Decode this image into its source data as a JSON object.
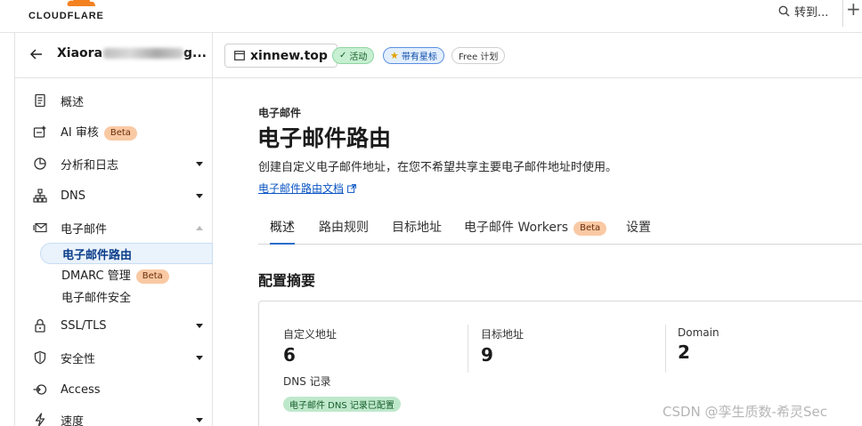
{
  "brand": {
    "name": "CLOUDFLARE",
    "accent_color": "#f48120"
  },
  "topbar": {
    "goto_label": "转到...",
    "add_label": "+"
  },
  "sidebar": {
    "account_name_prefix": "Xiaora",
    "account_name_suffix": "g...",
    "items": [
      {
        "label": "概述",
        "icon": "document-icon"
      },
      {
        "label": "AI 审核",
        "icon": "ai-audit-icon",
        "badge": "Beta"
      },
      {
        "label": "分析和日志",
        "icon": "chart-icon"
      },
      {
        "label": "DNS",
        "icon": "dns-network-icon"
      },
      {
        "label": "电子邮件",
        "icon": "email-icon"
      },
      {
        "label": "SSL/TLS",
        "icon": "lock-icon"
      },
      {
        "label": "安全性",
        "icon": "shield-icon"
      },
      {
        "label": "Access",
        "icon": "access-icon"
      },
      {
        "label": "速度",
        "icon": "lightning-icon"
      }
    ],
    "email_subitems": [
      {
        "label": "电子邮件路由",
        "active": true
      },
      {
        "label": "DMARC 管理",
        "badge": "Beta"
      },
      {
        "label": "电子邮件安全"
      }
    ]
  },
  "zone": {
    "name": "xinnew.top",
    "status": "活动",
    "starred": "带有星标",
    "plan": "Free 计划"
  },
  "page": {
    "breadcrumb": "电子邮件",
    "title": "电子邮件路由",
    "description": "创建自定义电子邮件地址，在您不希望共享主要电子邮件地址时使用。",
    "doc_link": "电子邮件路由文档"
  },
  "tabs": [
    {
      "label": "概述",
      "active": true
    },
    {
      "label": "路由规则"
    },
    {
      "label": "目标地址"
    },
    {
      "label": "电子邮件 Workers",
      "badge": "Beta"
    },
    {
      "label": "设置"
    }
  ],
  "summary": {
    "title": "配置摘要",
    "stats": [
      {
        "label": "自定义地址",
        "value": "6"
      },
      {
        "label": "目标地址",
        "value": "9"
      },
      {
        "label": "Domain",
        "value": "2"
      }
    ],
    "dns_label": "DNS 记录",
    "dns_status": "电子邮件 DNS 记录已配置"
  },
  "watermark": "CSDN @孪生质数-希灵Sec"
}
